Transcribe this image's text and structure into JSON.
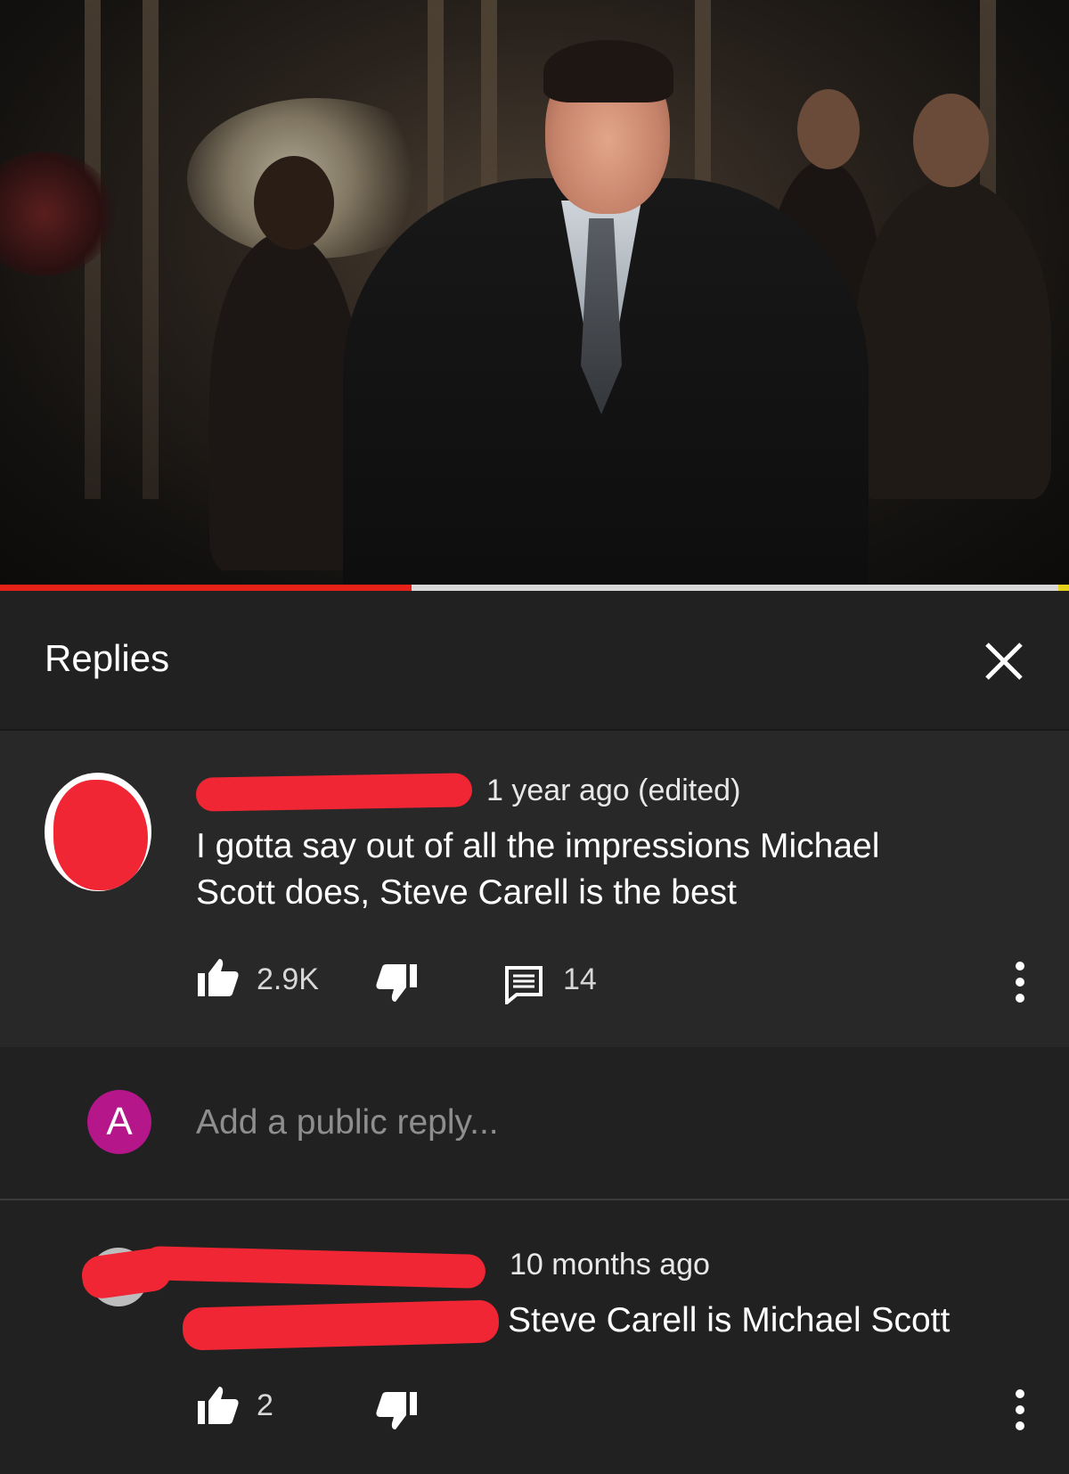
{
  "video": {
    "progress_percent": 38.5
  },
  "header": {
    "title": "Replies"
  },
  "comment": {
    "time": "1 year ago (edited)",
    "text_line1": "I gotta say out of all the impressions Michael",
    "text_line2": "Scott does, Steve Carell is the best",
    "likes": "2.9K",
    "replies": "14"
  },
  "reply_box": {
    "avatar_letter": "A",
    "placeholder": "Add a public reply..."
  },
  "reply": {
    "time": "10 months ago",
    "text": "Steve Carell is Michael Scott",
    "likes": "2"
  },
  "colors": {
    "background": "#212121",
    "card": "#282828",
    "accent_red": "#e62117",
    "avatar_purple": "#b5168a"
  },
  "icons": [
    "close-icon",
    "thumbs-up-icon",
    "thumbs-down-icon",
    "comment-icon",
    "more-vert-icon"
  ]
}
